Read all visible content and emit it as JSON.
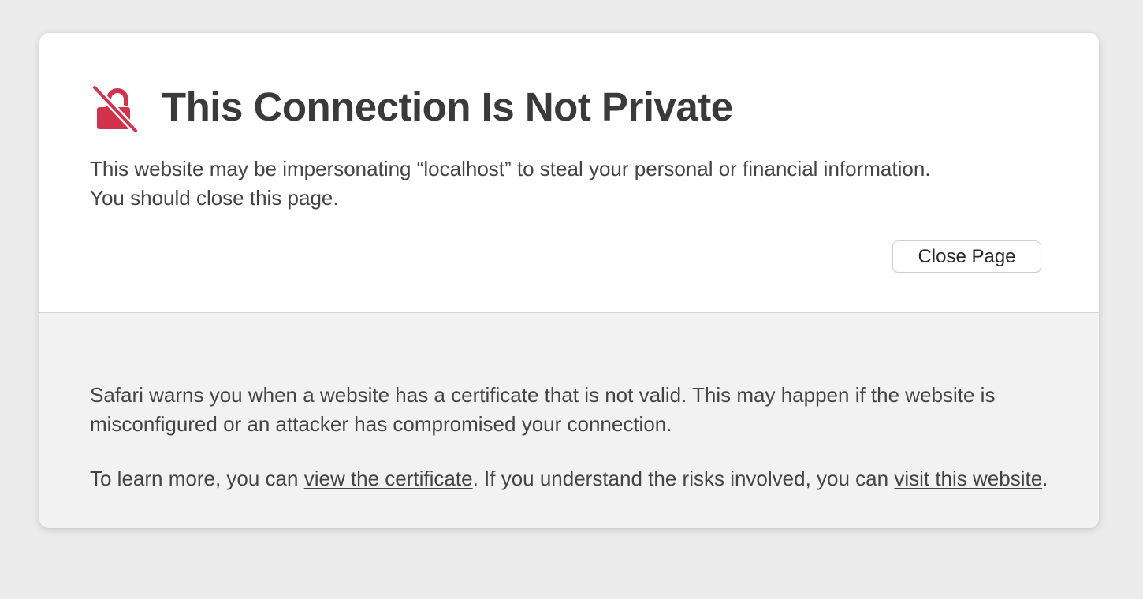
{
  "heading": {
    "icon": "broken-lock-icon",
    "title": "This Connection Is Not Private",
    "accent_color": "#d2334a"
  },
  "message": {
    "line1": "This website may be impersonating “localhost” to steal your personal or financial information.",
    "line2": "You should close this page."
  },
  "actions": {
    "close_label": "Close Page"
  },
  "details": {
    "explanation": "Safari warns you when a website has a certificate that is not valid. This may happen if the website is misconfigured or an attacker has compromised your connection.",
    "learn_prefix": "To learn more, you can ",
    "view_certificate_link": "view the certificate",
    "learn_middle": ". If you understand the risks involved, you can ",
    "visit_link": "visit this website",
    "learn_suffix": "."
  }
}
